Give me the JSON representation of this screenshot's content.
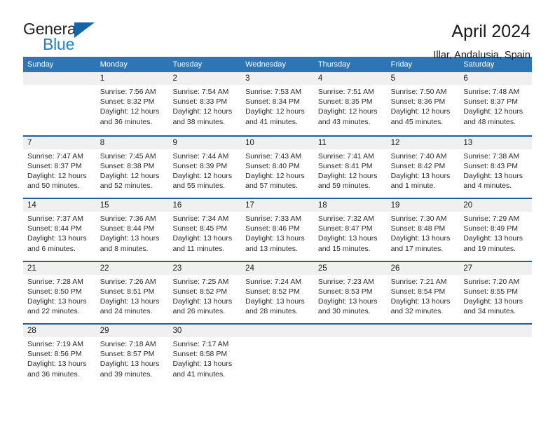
{
  "logo": {
    "word_one": "General",
    "word_two": "Blue",
    "triangle_icon": "triangle-icon"
  },
  "header": {
    "title": "April 2024",
    "subtitle": "Illar, Andalusia, Spain"
  },
  "colors": {
    "header_bar": "#2e75b6",
    "week_divider": "#1f5fa0",
    "daynum_band": "#f0f0f0",
    "logo_blue": "#1f7fd0",
    "logo_triangle": "#1565a8",
    "text": "#2b2b2b"
  },
  "weekdays": [
    "Sunday",
    "Monday",
    "Tuesday",
    "Wednesday",
    "Thursday",
    "Friday",
    "Saturday"
  ],
  "weeks": [
    {
      "days": [
        {
          "day": "",
          "empty": true
        },
        {
          "day": "1",
          "sunrise": "Sunrise: 7:56 AM",
          "sunset": "Sunset: 8:32 PM",
          "daylight": "Daylight: 12 hours and 36 minutes."
        },
        {
          "day": "2",
          "sunrise": "Sunrise: 7:54 AM",
          "sunset": "Sunset: 8:33 PM",
          "daylight": "Daylight: 12 hours and 38 minutes."
        },
        {
          "day": "3",
          "sunrise": "Sunrise: 7:53 AM",
          "sunset": "Sunset: 8:34 PM",
          "daylight": "Daylight: 12 hours and 41 minutes."
        },
        {
          "day": "4",
          "sunrise": "Sunrise: 7:51 AM",
          "sunset": "Sunset: 8:35 PM",
          "daylight": "Daylight: 12 hours and 43 minutes."
        },
        {
          "day": "5",
          "sunrise": "Sunrise: 7:50 AM",
          "sunset": "Sunset: 8:36 PM",
          "daylight": "Daylight: 12 hours and 45 minutes."
        },
        {
          "day": "6",
          "sunrise": "Sunrise: 7:48 AM",
          "sunset": "Sunset: 8:37 PM",
          "daylight": "Daylight: 12 hours and 48 minutes."
        }
      ]
    },
    {
      "days": [
        {
          "day": "7",
          "sunrise": "Sunrise: 7:47 AM",
          "sunset": "Sunset: 8:37 PM",
          "daylight": "Daylight: 12 hours and 50 minutes."
        },
        {
          "day": "8",
          "sunrise": "Sunrise: 7:45 AM",
          "sunset": "Sunset: 8:38 PM",
          "daylight": "Daylight: 12 hours and 52 minutes."
        },
        {
          "day": "9",
          "sunrise": "Sunrise: 7:44 AM",
          "sunset": "Sunset: 8:39 PM",
          "daylight": "Daylight: 12 hours and 55 minutes."
        },
        {
          "day": "10",
          "sunrise": "Sunrise: 7:43 AM",
          "sunset": "Sunset: 8:40 PM",
          "daylight": "Daylight: 12 hours and 57 minutes."
        },
        {
          "day": "11",
          "sunrise": "Sunrise: 7:41 AM",
          "sunset": "Sunset: 8:41 PM",
          "daylight": "Daylight: 12 hours and 59 minutes."
        },
        {
          "day": "12",
          "sunrise": "Sunrise: 7:40 AM",
          "sunset": "Sunset: 8:42 PM",
          "daylight": "Daylight: 13 hours and 1 minute."
        },
        {
          "day": "13",
          "sunrise": "Sunrise: 7:38 AM",
          "sunset": "Sunset: 8:43 PM",
          "daylight": "Daylight: 13 hours and 4 minutes."
        }
      ]
    },
    {
      "days": [
        {
          "day": "14",
          "sunrise": "Sunrise: 7:37 AM",
          "sunset": "Sunset: 8:44 PM",
          "daylight": "Daylight: 13 hours and 6 minutes."
        },
        {
          "day": "15",
          "sunrise": "Sunrise: 7:36 AM",
          "sunset": "Sunset: 8:44 PM",
          "daylight": "Daylight: 13 hours and 8 minutes."
        },
        {
          "day": "16",
          "sunrise": "Sunrise: 7:34 AM",
          "sunset": "Sunset: 8:45 PM",
          "daylight": "Daylight: 13 hours and 11 minutes."
        },
        {
          "day": "17",
          "sunrise": "Sunrise: 7:33 AM",
          "sunset": "Sunset: 8:46 PM",
          "daylight": "Daylight: 13 hours and 13 minutes."
        },
        {
          "day": "18",
          "sunrise": "Sunrise: 7:32 AM",
          "sunset": "Sunset: 8:47 PM",
          "daylight": "Daylight: 13 hours and 15 minutes."
        },
        {
          "day": "19",
          "sunrise": "Sunrise: 7:30 AM",
          "sunset": "Sunset: 8:48 PM",
          "daylight": "Daylight: 13 hours and 17 minutes."
        },
        {
          "day": "20",
          "sunrise": "Sunrise: 7:29 AM",
          "sunset": "Sunset: 8:49 PM",
          "daylight": "Daylight: 13 hours and 19 minutes."
        }
      ]
    },
    {
      "days": [
        {
          "day": "21",
          "sunrise": "Sunrise: 7:28 AM",
          "sunset": "Sunset: 8:50 PM",
          "daylight": "Daylight: 13 hours and 22 minutes."
        },
        {
          "day": "22",
          "sunrise": "Sunrise: 7:26 AM",
          "sunset": "Sunset: 8:51 PM",
          "daylight": "Daylight: 13 hours and 24 minutes."
        },
        {
          "day": "23",
          "sunrise": "Sunrise: 7:25 AM",
          "sunset": "Sunset: 8:52 PM",
          "daylight": "Daylight: 13 hours and 26 minutes."
        },
        {
          "day": "24",
          "sunrise": "Sunrise: 7:24 AM",
          "sunset": "Sunset: 8:52 PM",
          "daylight": "Daylight: 13 hours and 28 minutes."
        },
        {
          "day": "25",
          "sunrise": "Sunrise: 7:23 AM",
          "sunset": "Sunset: 8:53 PM",
          "daylight": "Daylight: 13 hours and 30 minutes."
        },
        {
          "day": "26",
          "sunrise": "Sunrise: 7:21 AM",
          "sunset": "Sunset: 8:54 PM",
          "daylight": "Daylight: 13 hours and 32 minutes."
        },
        {
          "day": "27",
          "sunrise": "Sunrise: 7:20 AM",
          "sunset": "Sunset: 8:55 PM",
          "daylight": "Daylight: 13 hours and 34 minutes."
        }
      ]
    },
    {
      "days": [
        {
          "day": "28",
          "sunrise": "Sunrise: 7:19 AM",
          "sunset": "Sunset: 8:56 PM",
          "daylight": "Daylight: 13 hours and 36 minutes."
        },
        {
          "day": "29",
          "sunrise": "Sunrise: 7:18 AM",
          "sunset": "Sunset: 8:57 PM",
          "daylight": "Daylight: 13 hours and 39 minutes."
        },
        {
          "day": "30",
          "sunrise": "Sunrise: 7:17 AM",
          "sunset": "Sunset: 8:58 PM",
          "daylight": "Daylight: 13 hours and 41 minutes."
        },
        {
          "day": "",
          "empty": true
        },
        {
          "day": "",
          "empty": true
        },
        {
          "day": "",
          "empty": true
        },
        {
          "day": "",
          "empty": true
        }
      ]
    }
  ]
}
